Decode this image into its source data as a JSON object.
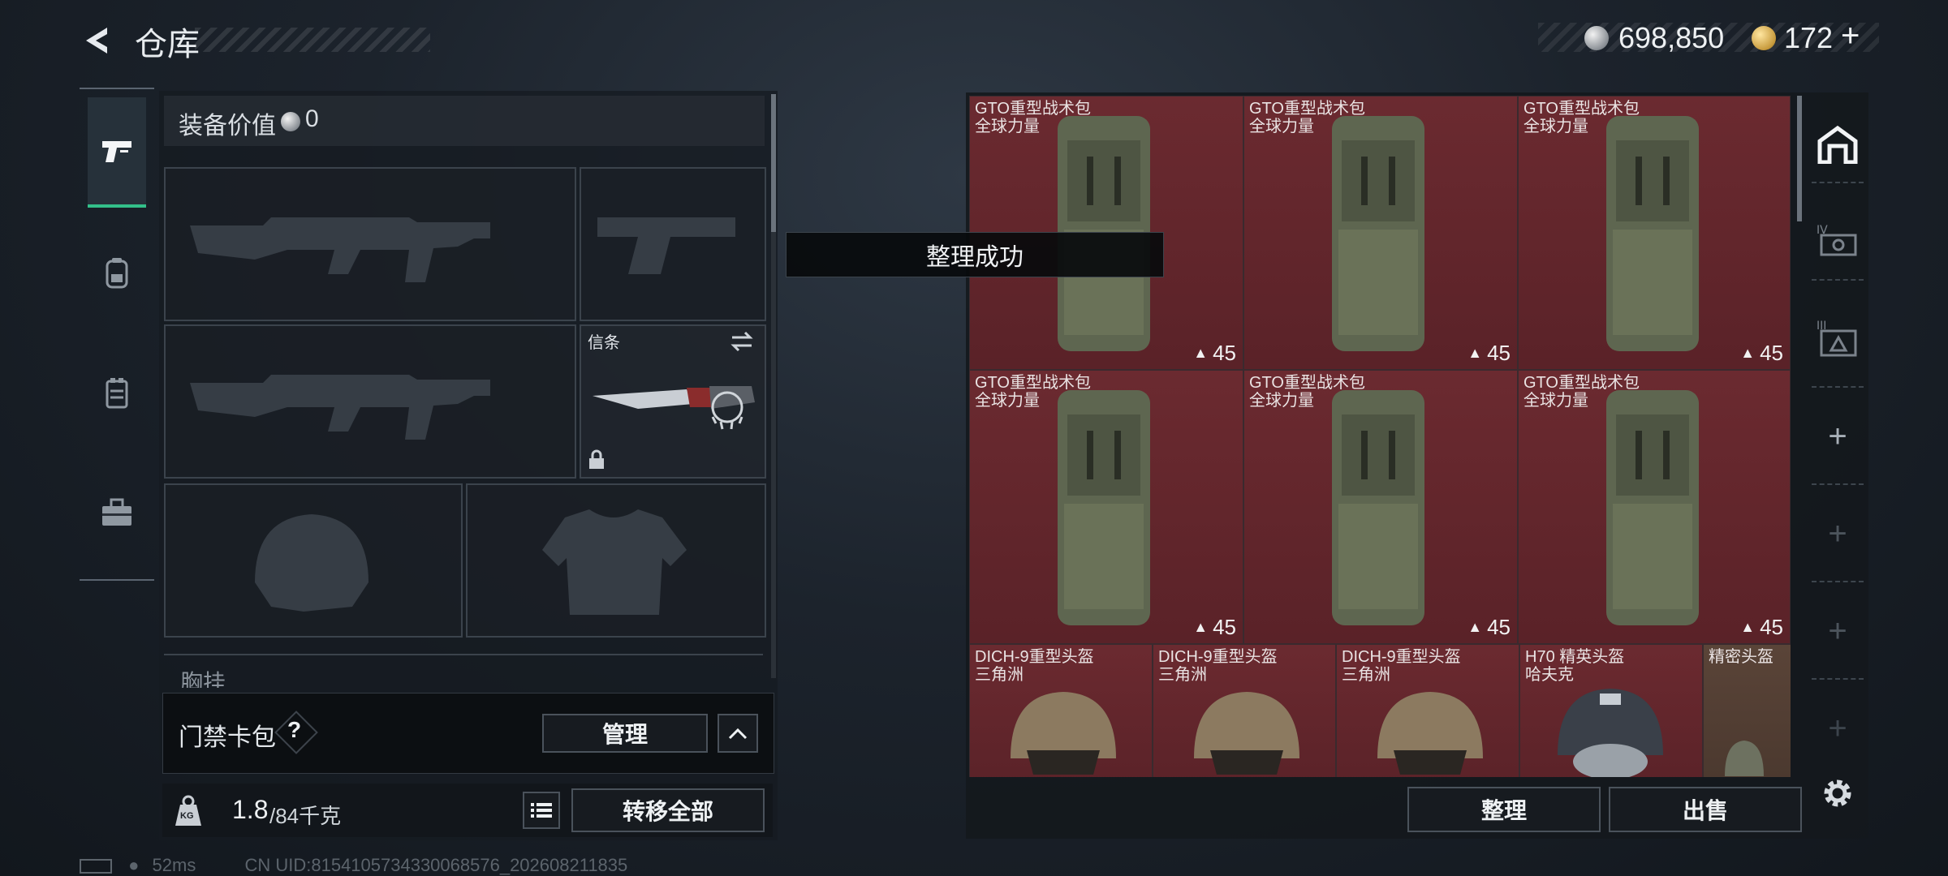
{
  "header": {
    "title": "仓库",
    "silver_amount": "698,850",
    "gold_amount": "172",
    "gold_add": "+"
  },
  "left_tabs": [
    "pistol-icon",
    "backpack-icon",
    "vest-icon",
    "toolbox-icon"
  ],
  "loadout": {
    "value_label": "装备价值",
    "value": "0",
    "knife_slot_label": "信条",
    "chest_label": "胸挂"
  },
  "keycard": {
    "label": "门禁卡包",
    "help": "?",
    "manage_button": "管理"
  },
  "footer": {
    "weight_current": "1.8",
    "weight_max": "/84千克",
    "kg_icon_text": "KG",
    "transfer_all_button": "转移全部"
  },
  "toast": "整理成功",
  "stash": {
    "backpacks": [
      {
        "name": "GTO重型战术包",
        "brand": "全球力量",
        "count": "45"
      },
      {
        "name": "GTO重型战术包",
        "brand": "全球力量",
        "count": "45"
      },
      {
        "name": "GTO重型战术包",
        "brand": "全球力量",
        "count": "45"
      },
      {
        "name": "GTO重型战术包",
        "brand": "全球力量",
        "count": "45"
      },
      {
        "name": "GTO重型战术包",
        "brand": "全球力量",
        "count": "45"
      },
      {
        "name": "GTO重型战术包",
        "brand": "全球力量",
        "count": "45"
      }
    ],
    "helmets": [
      {
        "name": "DICH-9重型头盔",
        "brand": "三角洲"
      },
      {
        "name": "DICH-9重型头盔",
        "brand": "三角洲"
      },
      {
        "name": "DICH-9重型头盔",
        "brand": "三角洲"
      },
      {
        "name": "H70 精英头盔",
        "brand": "哈夫克"
      },
      {
        "name": "精密头盔",
        "brand": ""
      }
    ],
    "sort_button": "整理",
    "sell_button": "出售"
  },
  "right_tabs": [
    "stash-home-icon",
    "container-iv-icon",
    "container-iii-icon"
  ],
  "status": {
    "ping": "52ms",
    "uid": "CN UID:8154105734330068576_202608211835"
  },
  "colors": {
    "accent_green": "#33c08a",
    "item_red": "#6b2a30"
  }
}
